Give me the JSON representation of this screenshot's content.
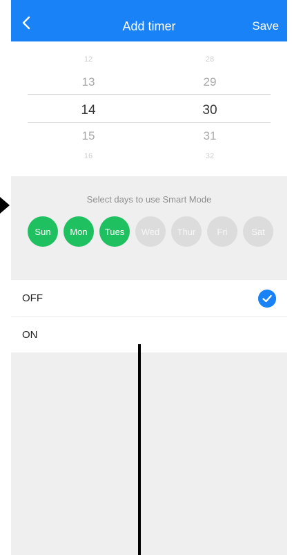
{
  "header": {
    "title": "Add timer",
    "save_label": "Save",
    "back_icon": "chevron-left-icon"
  },
  "picker": {
    "hours": [
      "12",
      "13",
      "14",
      "15",
      "16"
    ],
    "minutes": [
      "28",
      "29",
      "30",
      "31",
      "32"
    ],
    "selected_hour": "14",
    "selected_minute": "30"
  },
  "smart_mode": {
    "label": "Select days to use Smart Mode",
    "days": [
      {
        "label": "Sun",
        "active": true
      },
      {
        "label": "Mon",
        "active": true
      },
      {
        "label": "Tues",
        "active": true
      },
      {
        "label": "Wed",
        "active": false
      },
      {
        "label": "Thur",
        "active": false
      },
      {
        "label": "Fri",
        "active": false
      },
      {
        "label": "Sat",
        "active": false
      }
    ]
  },
  "options": [
    {
      "label": "OFF",
      "selected": true
    },
    {
      "label": "ON",
      "selected": false
    }
  ],
  "colors": {
    "accent": "#1a82f7",
    "day_active": "#1fc060",
    "day_inactive": "#dcdcdc"
  }
}
